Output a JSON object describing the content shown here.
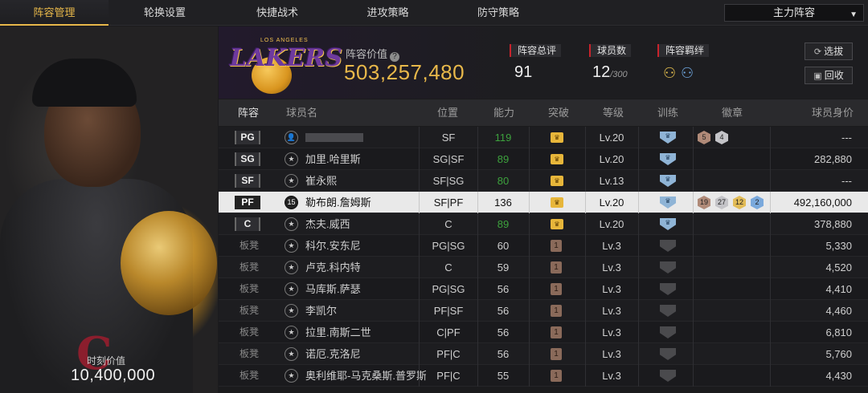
{
  "nav": {
    "tabs": [
      "阵容管理",
      "轮换设置",
      "快捷战术",
      "进攻策略",
      "防守策略"
    ],
    "active_tab": "阵容管理",
    "lineup_select": "主力阵容"
  },
  "left_panel": {
    "value_label": "时刻价值",
    "value": "10,400,000"
  },
  "header": {
    "team_logo_text": "LAKERS",
    "team_logo_top": "LOS ANGELES",
    "team_value_label": "阵容价值",
    "team_value": "503,257,480",
    "overall_label": "阵容总评",
    "overall_value": "91",
    "players_label": "球员数",
    "players_value": "12",
    "players_max": "/300",
    "bonds_label": "阵容羁绊",
    "select_button": "选拔",
    "recycle_button": "回收"
  },
  "table": {
    "headers": [
      "阵容",
      "球员名",
      "位置",
      "能力",
      "突破",
      "等级",
      "训练",
      "徽章",
      "球员身价"
    ],
    "rows": [
      {
        "slot": "PG",
        "name": "",
        "position": "SF",
        "ability": "119",
        "ability_green": true,
        "breakthrough": "crown",
        "level": "Lv.20",
        "training": "blue",
        "badges": [
          {
            "v": "5",
            "c": "bronze"
          },
          {
            "v": "4",
            "c": "silver"
          }
        ],
        "value": "---",
        "pic": "👤"
      },
      {
        "slot": "SG",
        "name": "加里.哈里斯",
        "position": "SG|SF",
        "ability": "89",
        "ability_green": true,
        "breakthrough": "crown",
        "level": "Lv.20",
        "training": "blue",
        "badges": [],
        "value": "282,880",
        "pic": "★"
      },
      {
        "slot": "SF",
        "name": "崔永熙",
        "position": "SF|SG",
        "ability": "80",
        "ability_green": true,
        "breakthrough": "crown",
        "level": "Lv.13",
        "training": "blue",
        "badges": [],
        "value": "---",
        "pic": "★"
      },
      {
        "slot": "PF",
        "name": "勒布朗.詹姆斯",
        "position": "SF|PF",
        "ability": "136",
        "ability_green": false,
        "breakthrough": "crown",
        "level": "Lv.20",
        "training": "blue",
        "badges": [
          {
            "v": "19",
            "c": "bronze"
          },
          {
            "v": "27",
            "c": "silver"
          },
          {
            "v": "12",
            "c": "gold"
          },
          {
            "v": "2",
            "c": "blue"
          }
        ],
        "value": "492,160,000",
        "pic": "15"
      },
      {
        "slot": "C",
        "name": "杰夫.威西",
        "position": "C",
        "ability": "89",
        "ability_green": true,
        "breakthrough": "crown",
        "level": "Lv.20",
        "training": "blue",
        "badges": [],
        "value": "378,880",
        "pic": "★"
      },
      {
        "slot": "板凳",
        "name": "科尔.安东尼",
        "position": "PG|SG",
        "ability": "60",
        "ability_green": false,
        "breakthrough": "1",
        "level": "Lv.3",
        "training": "grey",
        "badges": [],
        "value": "5,330",
        "pic": "★"
      },
      {
        "slot": "板凳",
        "name": "卢克.科内特",
        "position": "C",
        "ability": "59",
        "ability_green": false,
        "breakthrough": "1",
        "level": "Lv.3",
        "training": "grey",
        "badges": [],
        "value": "4,520",
        "pic": "★"
      },
      {
        "slot": "板凳",
        "name": "马库斯.萨瑟",
        "position": "PG|SG",
        "ability": "56",
        "ability_green": false,
        "breakthrough": "1",
        "level": "Lv.3",
        "training": "grey",
        "badges": [],
        "value": "4,410",
        "pic": "★"
      },
      {
        "slot": "板凳",
        "name": "李凯尔",
        "position": "PF|SF",
        "ability": "56",
        "ability_green": false,
        "breakthrough": "1",
        "level": "Lv.3",
        "training": "grey",
        "badges": [],
        "value": "4,460",
        "pic": "★"
      },
      {
        "slot": "板凳",
        "name": "拉里.南斯二世",
        "position": "C|PF",
        "ability": "56",
        "ability_green": false,
        "breakthrough": "1",
        "level": "Lv.3",
        "training": "grey",
        "badges": [],
        "value": "6,810",
        "pic": "★"
      },
      {
        "slot": "板凳",
        "name": "诺厄.克洛尼",
        "position": "PF|C",
        "ability": "56",
        "ability_green": false,
        "breakthrough": "1",
        "level": "Lv.3",
        "training": "grey",
        "badges": [],
        "value": "5,760",
        "pic": "★"
      },
      {
        "slot": "板凳",
        "name": "奥利维耶-马克桑斯.普罗斯珥",
        "position": "PF|C",
        "ability": "55",
        "ability_green": false,
        "breakthrough": "1",
        "level": "Lv.3",
        "training": "grey",
        "badges": [],
        "value": "4,430",
        "pic": "★"
      }
    ],
    "highlight_row": 3
  },
  "colors": {
    "accent": "#e8b84a",
    "green": "#3da23d",
    "red_marker": "#c8232c"
  }
}
